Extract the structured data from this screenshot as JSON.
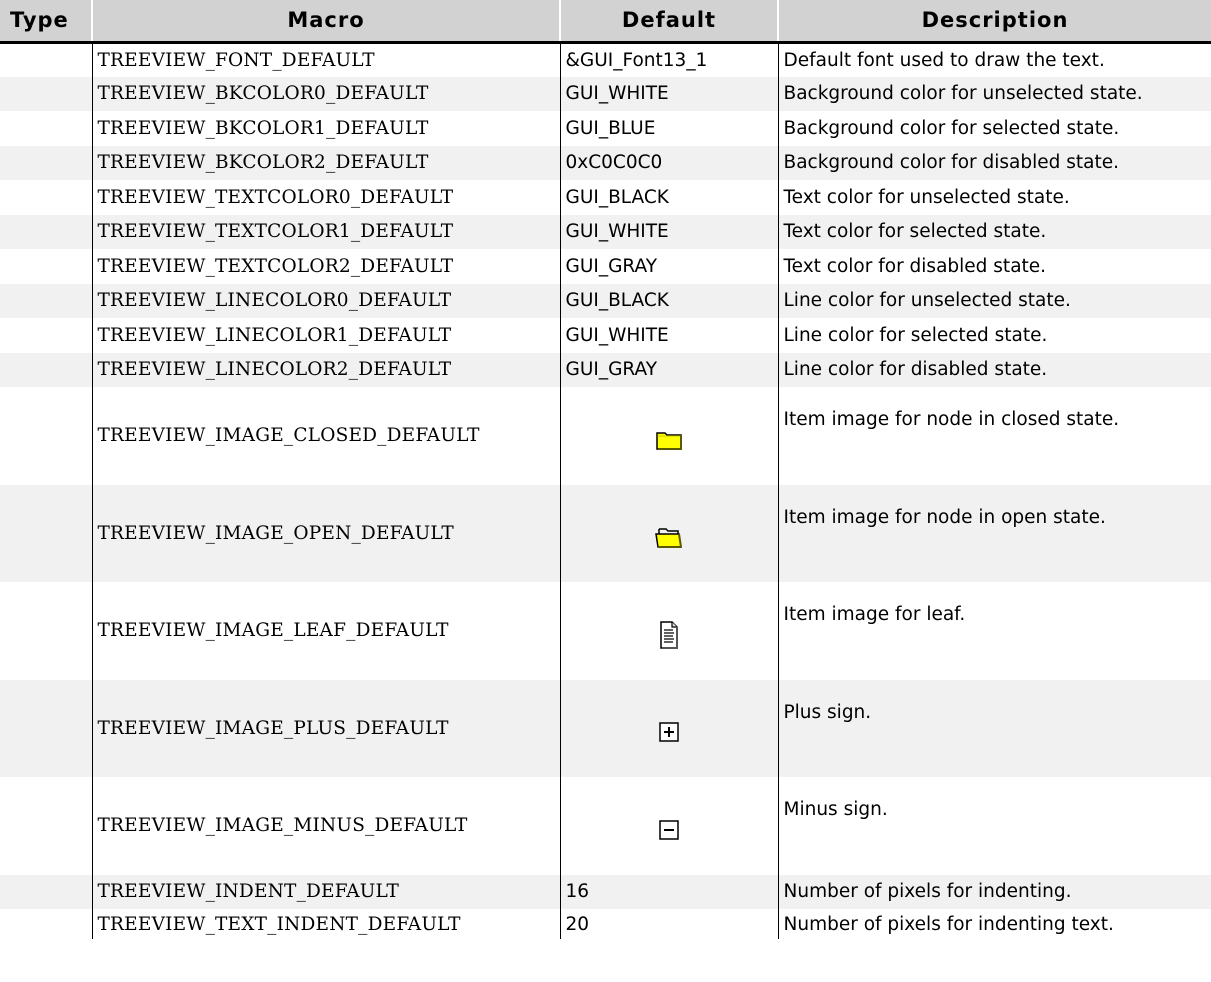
{
  "headers": {
    "type": "Type",
    "macro": "Macro",
    "default": "Default",
    "description": "Description"
  },
  "rows": [
    {
      "type": "",
      "macro": "TREEVIEW_FONT_DEFAULT",
      "default": "&GUI_Font13_1",
      "description": "Default font used to draw the text."
    },
    {
      "type": "",
      "macro": "TREEVIEW_BKCOLOR0_DEFAULT",
      "default": "GUI_WHITE",
      "description": "Background color for unselected state."
    },
    {
      "type": "",
      "macro": "TREEVIEW_BKCOLOR1_DEFAULT",
      "default": "GUI_BLUE",
      "description": "Background color for selected state."
    },
    {
      "type": "",
      "macro": "TREEVIEW_BKCOLOR2_DEFAULT",
      "default": "0xC0C0C0",
      "description": "Background color for disabled state."
    },
    {
      "type": "",
      "macro": "TREEVIEW_TEXTCOLOR0_DEFAULT",
      "default": "GUI_BLACK",
      "description": "Text color for unselected state."
    },
    {
      "type": "",
      "macro": "TREEVIEW_TEXTCOLOR1_DEFAULT",
      "default": "GUI_WHITE",
      "description": "Text color for selected state."
    },
    {
      "type": "",
      "macro": "TREEVIEW_TEXTCOLOR2_DEFAULT",
      "default": "GUI_GRAY",
      "description": "Text color for disabled state."
    },
    {
      "type": "",
      "macro": "TREEVIEW_LINECOLOR0_DEFAULT",
      "default": "GUI_BLACK",
      "description": "Line color for unselected state."
    },
    {
      "type": "",
      "macro": "TREEVIEW_LINECOLOR1_DEFAULT",
      "default": "GUI_WHITE",
      "description": "Line color for selected state."
    },
    {
      "type": "",
      "macro": "TREEVIEW_LINECOLOR2_DEFAULT",
      "default": "GUI_GRAY",
      "description": "Line color for disabled state."
    },
    {
      "type": "",
      "macro": "TREEVIEW_IMAGE_CLOSED_DEFAULT",
      "default_icon": "folder-closed-icon",
      "description": "Item image for node in closed state."
    },
    {
      "type": "",
      "macro": "TREEVIEW_IMAGE_OPEN_DEFAULT",
      "default_icon": "folder-open-icon",
      "description": "Item image for node in open state."
    },
    {
      "type": "",
      "macro": "TREEVIEW_IMAGE_LEAF_DEFAULT",
      "default_icon": "document-leaf-icon",
      "description": "Item image for leaf."
    },
    {
      "type": "",
      "macro": "TREEVIEW_IMAGE_PLUS_DEFAULT",
      "default_icon": "plus-box-icon",
      "description": "Plus sign."
    },
    {
      "type": "",
      "macro": "TREEVIEW_IMAGE_MINUS_DEFAULT",
      "default_icon": "minus-box-icon",
      "description": "Minus sign."
    },
    {
      "type": "",
      "macro": "TREEVIEW_INDENT_DEFAULT",
      "default": "16",
      "description": "Number of pixels for indenting."
    },
    {
      "type": "",
      "macro": "TREEVIEW_TEXT_INDENT_DEFAULT",
      "default": "20",
      "description": "Number of pixels for indenting text."
    }
  ],
  "colors": {
    "header_bg": "#d2d2d2",
    "row_alt_bg": "#f1f1f1",
    "folder_yellow": "#ffff00"
  }
}
